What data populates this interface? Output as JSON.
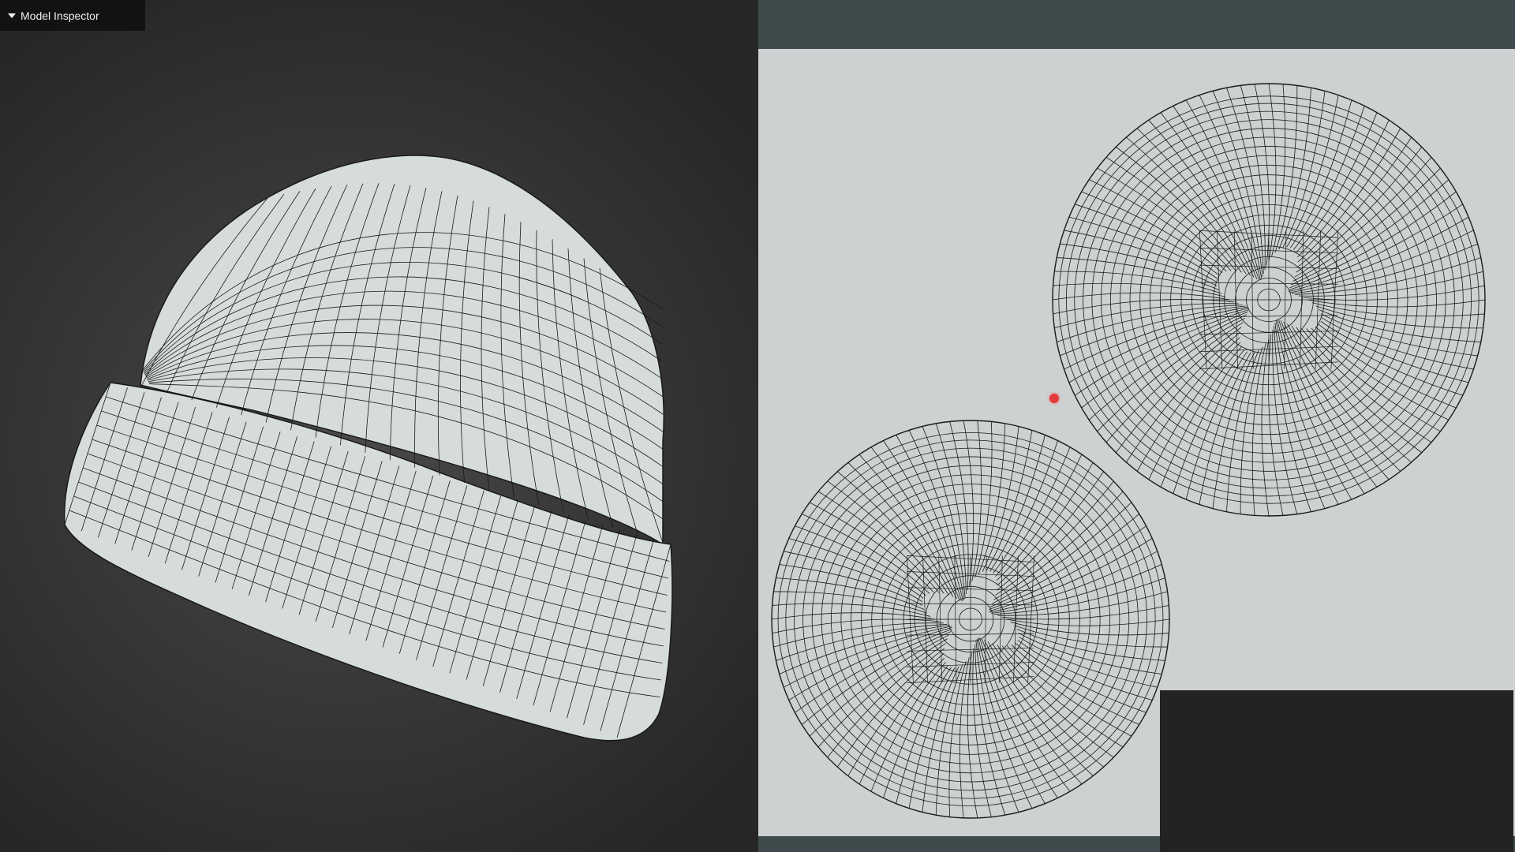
{
  "inspector": {
    "title": "Model Inspector",
    "toggle_icon": "caret-down-icon"
  },
  "viewport": {
    "model": "beanie-hat-wireframe",
    "background_color": "#3a3a3a",
    "mesh_fill": "#d6dcdc",
    "wire_color": "#1a1a1a"
  },
  "uv_editor": {
    "canvas_color": "#cdd1d2",
    "frame_color": "#3e4a4b",
    "marker_color": "#e23b3b"
  }
}
